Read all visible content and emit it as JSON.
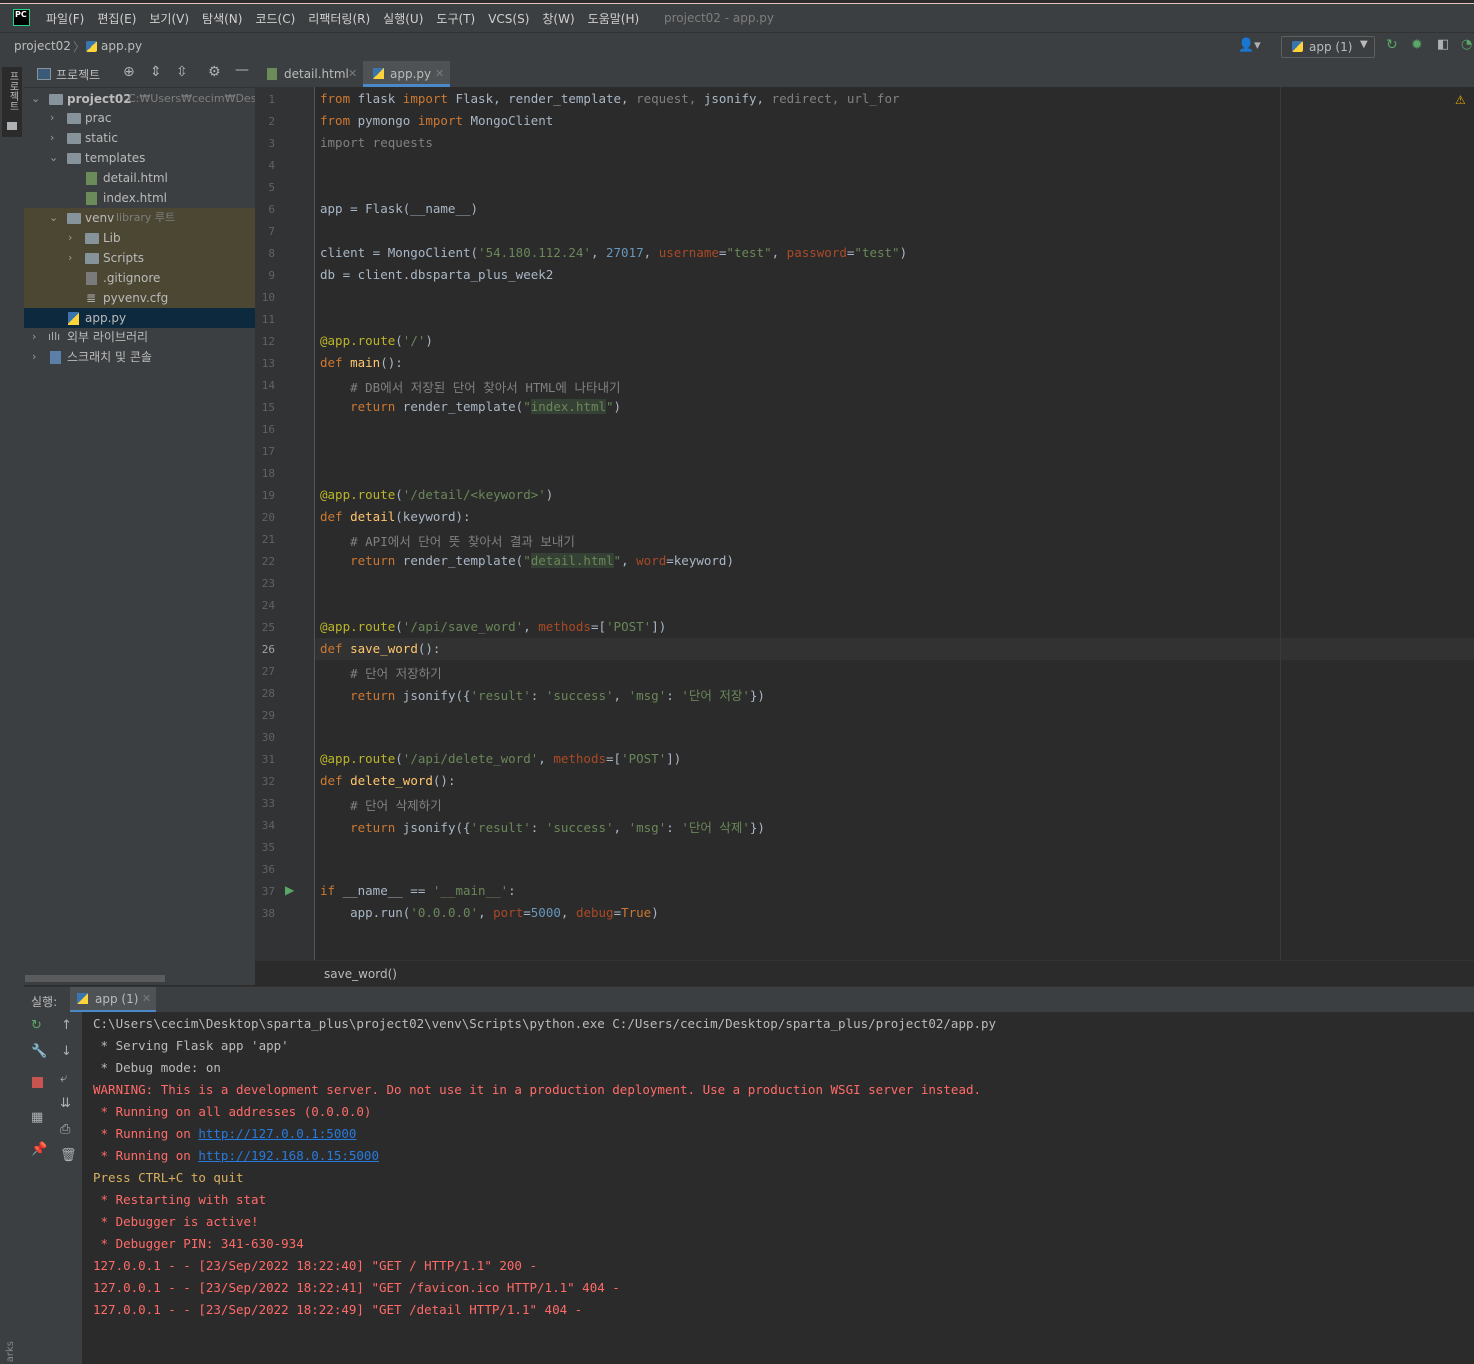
{
  "app": {
    "logo": "PC",
    "window_title": "project02 - app.py"
  },
  "menu": [
    "파일(F)",
    "편집(E)",
    "보기(V)",
    "탐색(N)",
    "코드(C)",
    "리팩터링(R)",
    "실행(U)",
    "도구(T)",
    "VCS(S)",
    "창(W)",
    "도움말(H)"
  ],
  "nav": {
    "project": "project02",
    "file": "app.py",
    "run_config": "app (1)"
  },
  "left_strip": {
    "project_label": "프로젝트",
    "bottom_label": "arks"
  },
  "project_panel": {
    "title": "프로젝트",
    "tree": [
      {
        "label": "project02",
        "extra": "C:₩Users₩cecim₩Deskt",
        "type": "folder",
        "expanded": true
      },
      {
        "label": "prac",
        "type": "folder"
      },
      {
        "label": "static",
        "type": "folder"
      },
      {
        "label": "templates",
        "type": "folder",
        "expanded": true
      },
      {
        "label": "detail.html",
        "type": "html"
      },
      {
        "label": "index.html",
        "type": "html"
      },
      {
        "label": "venv",
        "extra": "library 루트",
        "type": "folder",
        "expanded": true
      },
      {
        "label": "Lib",
        "type": "folder"
      },
      {
        "label": "Scripts",
        "type": "folder"
      },
      {
        "label": ".gitignore",
        "type": "file"
      },
      {
        "label": "pyvenv.cfg",
        "type": "cfg"
      },
      {
        "label": "app.py",
        "type": "py"
      },
      {
        "label": "외부 라이브러리",
        "type": "lib"
      },
      {
        "label": "스크래치 및 콘솔",
        "type": "scratch"
      }
    ]
  },
  "tabs": [
    {
      "label": "detail.html"
    },
    {
      "label": "app.py"
    }
  ],
  "code_lines": [
    "1",
    "2",
    "3",
    "4",
    "5",
    "6",
    "7",
    "8",
    "9",
    "10",
    "11",
    "12",
    "13",
    "14",
    "15",
    "16",
    "17",
    "18",
    "19",
    "20",
    "21",
    "22",
    "23",
    "24",
    "25",
    "26",
    "27",
    "28",
    "29",
    "30",
    "31",
    "32",
    "33",
    "34",
    "35",
    "36",
    "37",
    "38"
  ],
  "code": {
    "l1": {
      "k1": "from",
      "m1": " flask ",
      "k2": "import",
      "m2": " Flask, render_template, ",
      "d1": "request, ",
      "m3": "jsonify, ",
      "d2": "redirect, url_for"
    },
    "l2": {
      "k1": "from",
      "m1": " pymongo ",
      "k2": "import",
      "m2": " MongoClient"
    },
    "l3": {
      "d1": "import requests"
    },
    "l6": {
      "m1": "app = Flask(__name__)"
    },
    "l8": {
      "m1": "client = MongoClient(",
      "s1": "'54.180.112.24'",
      "m2": ", ",
      "n1": "27017",
      "m3": ", ",
      "p1": "username",
      "m4": "=",
      "s2": "\"test\"",
      "m5": ", ",
      "p2": "password",
      "m6": "=",
      "s3": "\"test\"",
      "m7": ")"
    },
    "l9": {
      "m1": "db = client.dbsparta_plus_week2"
    },
    "l12": {
      "dec": "@app.route",
      "m1": "(",
      "s1": "'/'",
      "m2": ")"
    },
    "l13": {
      "k1": "def ",
      "f1": "main",
      "m1": "():"
    },
    "l14": {
      "c1": "# DB에서 저장된 단어 찾아서 HTML에 나타내기"
    },
    "l15": {
      "k1": "return ",
      "m1": "render_template(",
      "s1": "\"",
      "h1": "index.html",
      "s2": "\"",
      "m2": ")"
    },
    "l19": {
      "dec": "@app.route",
      "m1": "(",
      "s1": "'/detail/<keyword>'",
      "m2": ")"
    },
    "l20": {
      "k1": "def ",
      "f1": "detail",
      "m1": "(keyword):"
    },
    "l21": {
      "c1": "# API에서 단어 뜻 찾아서 결과 보내기"
    },
    "l22": {
      "k1": "return ",
      "m1": "render_template(",
      "s1": "\"",
      "h1": "detail.html",
      "s2": "\"",
      "m2": ", ",
      "p1": "word",
      "m3": "=keyword)"
    },
    "l25": {
      "dec": "@app.route",
      "m1": "(",
      "s1": "'/api/save_word'",
      "m2": ", ",
      "p1": "methods",
      "m3": "=[",
      "s2": "'POST'",
      "m4": "])"
    },
    "l26": {
      "k1": "def ",
      "f1": "save_word",
      "m1": "():"
    },
    "l27": {
      "c1": "# 단어 저장하기"
    },
    "l28": {
      "k1": "return ",
      "m1": "jsonify({",
      "s1": "'result'",
      "m2": ": ",
      "s2": "'success'",
      "m3": ", ",
      "s3": "'msg'",
      "m4": ": ",
      "s4": "'단어 저장'",
      "m5": "})"
    },
    "l31": {
      "dec": "@app.route",
      "m1": "(",
      "s1": "'/api/delete_word'",
      "m2": ", ",
      "p1": "methods",
      "m3": "=[",
      "s2": "'POST'",
      "m4": "])"
    },
    "l32": {
      "k1": "def ",
      "f1": "delete_word",
      "m1": "():"
    },
    "l33": {
      "c1": "# 단어 삭제하기"
    },
    "l34": {
      "k1": "return ",
      "m1": "jsonify({",
      "s1": "'result'",
      "m2": ": ",
      "s2": "'success'",
      "m3": ", ",
      "s3": "'msg'",
      "m4": ": ",
      "s4": "'단어 삭제'",
      "m5": "})"
    },
    "l37": {
      "k1": "if ",
      "m1": "__name__ == ",
      "s1": "'__main__'",
      "m2": ":"
    },
    "l38": {
      "m1": "app.run(",
      "s1": "'0.0.0.0'",
      "m2": ", ",
      "p1": "port",
      "m3": "=",
      "n1": "5000",
      "m4": ", ",
      "p2": "debug",
      "m5": "=",
      "k1": "True",
      "m6": ")"
    }
  },
  "breadcrumb": "save_word()",
  "run": {
    "label": "실행:",
    "tab": "app (1)",
    "lines": [
      {
        "t": "C:\\Users\\cecim\\Desktop\\sparta_plus\\project02\\venv\\Scripts\\python.exe C:/Users/cecim/Desktop/sparta_plus/project02/app.py",
        "c": "norm"
      },
      {
        "t": " * Serving Flask app 'app'",
        "c": "norm"
      },
      {
        "t": " * Debug mode: on",
        "c": "norm"
      },
      {
        "t": "WARNING: This is a development server. Do not use it in a production deployment. Use a production WSGI server instead.",
        "c": "red"
      },
      {
        "t": " * Running on all addresses (0.0.0.0)",
        "c": "red"
      },
      {
        "t": " * Running on ",
        "c": "red",
        "link": "http://127.0.0.1:5000"
      },
      {
        "t": " * Running on ",
        "c": "red",
        "link": "http://192.168.0.15:5000"
      },
      {
        "t": "Press CTRL+C to quit",
        "c": "yel"
      },
      {
        "t": " * Restarting with stat",
        "c": "red"
      },
      {
        "t": " * Debugger is active!",
        "c": "red"
      },
      {
        "t": " * Debugger PIN: 341-630-934",
        "c": "red"
      },
      {
        "t": "127.0.0.1 - - [23/Sep/2022 18:22:40] \"GET / HTTP/1.1\" 200 -",
        "c": "red"
      },
      {
        "t": "127.0.0.1 - - [23/Sep/2022 18:22:41] \"GET /favicon.ico HTTP/1.1\" 404 -",
        "c": "red"
      },
      {
        "t": "127.0.0.1 - - [23/Sep/2022 18:22:49] \"GET /detail HTTP/1.1\" 404 -",
        "c": "red"
      }
    ]
  }
}
